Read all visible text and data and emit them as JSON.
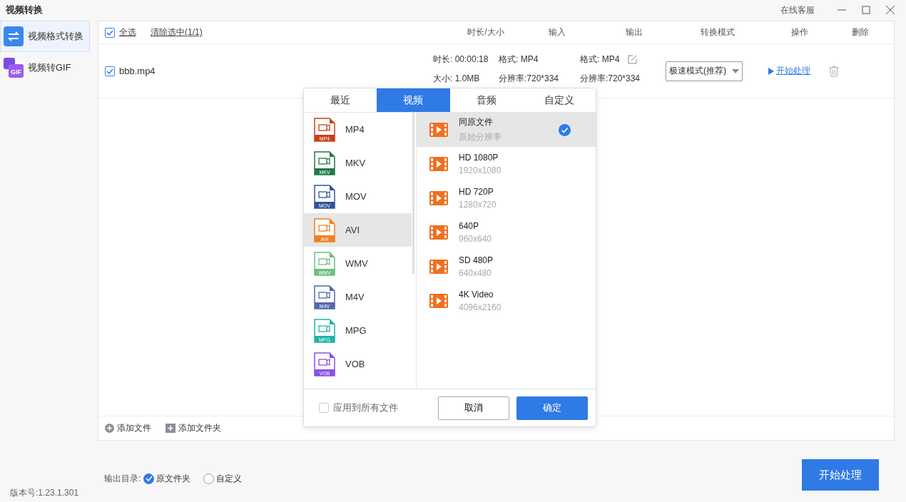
{
  "window": {
    "title": "视频转换",
    "service": "在线客服"
  },
  "sidebar": {
    "items": [
      {
        "label": "视频格式转换",
        "kind": "convert",
        "selected": true
      },
      {
        "label": "视频转GIF",
        "kind": "gif",
        "badge": "GIF",
        "selected": false
      }
    ]
  },
  "table": {
    "select_all": {
      "label": "全选",
      "checked": true
    },
    "clear_selection": "清除选中(1/1)",
    "columns": [
      "时长/大小",
      "输入",
      "输出",
      "转换模式",
      "操作",
      "删除"
    ],
    "rows": [
      {
        "checked": true,
        "name": "bbb.mp4",
        "duration": "时长: 00:00:18",
        "size": "大小: 1.0MB",
        "input_format": "格式: MP4",
        "input_resolution": "分辨率:720*334",
        "output_format": "格式: MP4",
        "output_resolution": "分辨率:720*334",
        "mode": "极速模式(推荐)",
        "action": "开始处理"
      }
    ]
  },
  "format_popup": {
    "tabs": [
      {
        "label": "最近",
        "selected": false
      },
      {
        "label": "视频",
        "selected": true
      },
      {
        "label": "音频",
        "selected": false
      },
      {
        "label": "自定义",
        "selected": false
      }
    ],
    "formats": [
      {
        "label": "MP4",
        "badge": "MP4",
        "color": "#c9401b",
        "selected": false
      },
      {
        "label": "MKV",
        "badge": "MKV",
        "color": "#1f7a45",
        "selected": false
      },
      {
        "label": "MOV",
        "badge": "MOV",
        "color": "#2f5597",
        "selected": false
      },
      {
        "label": "AVI",
        "badge": "AVI",
        "color": "#f07f23",
        "selected": true
      },
      {
        "label": "WMV",
        "badge": "WMV",
        "color": "#6dbf7b",
        "selected": false
      },
      {
        "label": "M4V",
        "badge": "M4V",
        "color": "#5468b0",
        "selected": false
      },
      {
        "label": "MPG",
        "badge": "MPG",
        "color": "#1fb5a6",
        "selected": false
      },
      {
        "label": "VOB",
        "badge": "VOB",
        "color": "#8a4fe6",
        "selected": false
      }
    ],
    "presets": [
      {
        "title": "同原文件",
        "subtitle": "原始分辨率",
        "selected": true
      },
      {
        "title": "HD 1080P",
        "subtitle": "1920x1080",
        "selected": false
      },
      {
        "title": "HD 720P",
        "subtitle": "1280x720",
        "selected": false
      },
      {
        "title": "640P",
        "subtitle": "960x640",
        "selected": false
      },
      {
        "title": "SD 480P",
        "subtitle": "640x480",
        "selected": false
      },
      {
        "title": "4K Video",
        "subtitle": "4096x2160",
        "selected": false
      }
    ],
    "apply_all": {
      "label": "应用到所有文件",
      "checked": false
    },
    "cancel": "取消",
    "confirm": "确定"
  },
  "toolbar": {
    "add_file": "添加文件",
    "add_folder": "添加文件夹"
  },
  "output_dir": {
    "label": "输出目录:",
    "options": [
      {
        "label": "原文件夹",
        "selected": true
      },
      {
        "label": "自定义",
        "selected": false
      }
    ]
  },
  "start_button": "开始处理",
  "version": "版本号:1.23.1.301"
}
